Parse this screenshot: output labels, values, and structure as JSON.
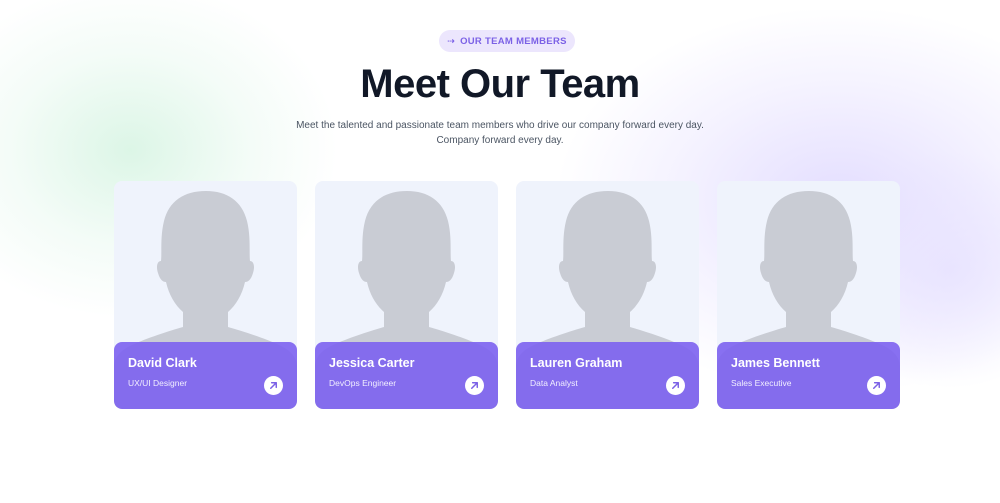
{
  "badge": {
    "label": "OUR TEAM MEMBERS",
    "icon": "arrow-right-icon"
  },
  "heading": "Meet Our Team",
  "subtitle": {
    "line1": "Meet the talented and passionate team members who drive our company forward every day.",
    "line2": "Company forward every day."
  },
  "colors": {
    "accent": "#7b61e6",
    "card_panel": "#7c62f0",
    "card_bg": "#eff3fc",
    "heading": "#111827",
    "avatar_silhouette": "#c9ccd4"
  },
  "team": [
    {
      "name": "David Clark",
      "role": "UX/UI Designer"
    },
    {
      "name": "Jessica Carter",
      "role": "DevOps Engineer"
    },
    {
      "name": "Lauren Graham",
      "role": "Data Analyst"
    },
    {
      "name": "James Bennett",
      "role": "Sales Executive"
    }
  ]
}
